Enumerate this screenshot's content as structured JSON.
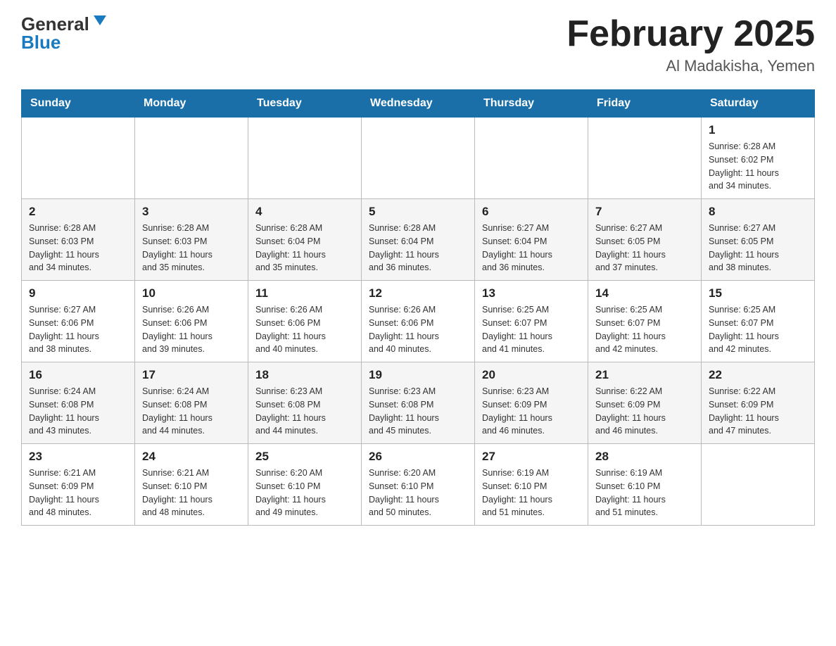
{
  "header": {
    "logo_general": "General",
    "logo_blue": "Blue",
    "month_title": "February 2025",
    "location": "Al Madakisha, Yemen"
  },
  "weekdays": [
    "Sunday",
    "Monday",
    "Tuesday",
    "Wednesday",
    "Thursday",
    "Friday",
    "Saturday"
  ],
  "weeks": [
    [
      {
        "day": "",
        "info": ""
      },
      {
        "day": "",
        "info": ""
      },
      {
        "day": "",
        "info": ""
      },
      {
        "day": "",
        "info": ""
      },
      {
        "day": "",
        "info": ""
      },
      {
        "day": "",
        "info": ""
      },
      {
        "day": "1",
        "info": "Sunrise: 6:28 AM\nSunset: 6:02 PM\nDaylight: 11 hours\nand 34 minutes."
      }
    ],
    [
      {
        "day": "2",
        "info": "Sunrise: 6:28 AM\nSunset: 6:03 PM\nDaylight: 11 hours\nand 34 minutes."
      },
      {
        "day": "3",
        "info": "Sunrise: 6:28 AM\nSunset: 6:03 PM\nDaylight: 11 hours\nand 35 minutes."
      },
      {
        "day": "4",
        "info": "Sunrise: 6:28 AM\nSunset: 6:04 PM\nDaylight: 11 hours\nand 35 minutes."
      },
      {
        "day": "5",
        "info": "Sunrise: 6:28 AM\nSunset: 6:04 PM\nDaylight: 11 hours\nand 36 minutes."
      },
      {
        "day": "6",
        "info": "Sunrise: 6:27 AM\nSunset: 6:04 PM\nDaylight: 11 hours\nand 36 minutes."
      },
      {
        "day": "7",
        "info": "Sunrise: 6:27 AM\nSunset: 6:05 PM\nDaylight: 11 hours\nand 37 minutes."
      },
      {
        "day": "8",
        "info": "Sunrise: 6:27 AM\nSunset: 6:05 PM\nDaylight: 11 hours\nand 38 minutes."
      }
    ],
    [
      {
        "day": "9",
        "info": "Sunrise: 6:27 AM\nSunset: 6:06 PM\nDaylight: 11 hours\nand 38 minutes."
      },
      {
        "day": "10",
        "info": "Sunrise: 6:26 AM\nSunset: 6:06 PM\nDaylight: 11 hours\nand 39 minutes."
      },
      {
        "day": "11",
        "info": "Sunrise: 6:26 AM\nSunset: 6:06 PM\nDaylight: 11 hours\nand 40 minutes."
      },
      {
        "day": "12",
        "info": "Sunrise: 6:26 AM\nSunset: 6:06 PM\nDaylight: 11 hours\nand 40 minutes."
      },
      {
        "day": "13",
        "info": "Sunrise: 6:25 AM\nSunset: 6:07 PM\nDaylight: 11 hours\nand 41 minutes."
      },
      {
        "day": "14",
        "info": "Sunrise: 6:25 AM\nSunset: 6:07 PM\nDaylight: 11 hours\nand 42 minutes."
      },
      {
        "day": "15",
        "info": "Sunrise: 6:25 AM\nSunset: 6:07 PM\nDaylight: 11 hours\nand 42 minutes."
      }
    ],
    [
      {
        "day": "16",
        "info": "Sunrise: 6:24 AM\nSunset: 6:08 PM\nDaylight: 11 hours\nand 43 minutes."
      },
      {
        "day": "17",
        "info": "Sunrise: 6:24 AM\nSunset: 6:08 PM\nDaylight: 11 hours\nand 44 minutes."
      },
      {
        "day": "18",
        "info": "Sunrise: 6:23 AM\nSunset: 6:08 PM\nDaylight: 11 hours\nand 44 minutes."
      },
      {
        "day": "19",
        "info": "Sunrise: 6:23 AM\nSunset: 6:08 PM\nDaylight: 11 hours\nand 45 minutes."
      },
      {
        "day": "20",
        "info": "Sunrise: 6:23 AM\nSunset: 6:09 PM\nDaylight: 11 hours\nand 46 minutes."
      },
      {
        "day": "21",
        "info": "Sunrise: 6:22 AM\nSunset: 6:09 PM\nDaylight: 11 hours\nand 46 minutes."
      },
      {
        "day": "22",
        "info": "Sunrise: 6:22 AM\nSunset: 6:09 PM\nDaylight: 11 hours\nand 47 minutes."
      }
    ],
    [
      {
        "day": "23",
        "info": "Sunrise: 6:21 AM\nSunset: 6:09 PM\nDaylight: 11 hours\nand 48 minutes."
      },
      {
        "day": "24",
        "info": "Sunrise: 6:21 AM\nSunset: 6:10 PM\nDaylight: 11 hours\nand 48 minutes."
      },
      {
        "day": "25",
        "info": "Sunrise: 6:20 AM\nSunset: 6:10 PM\nDaylight: 11 hours\nand 49 minutes."
      },
      {
        "day": "26",
        "info": "Sunrise: 6:20 AM\nSunset: 6:10 PM\nDaylight: 11 hours\nand 50 minutes."
      },
      {
        "day": "27",
        "info": "Sunrise: 6:19 AM\nSunset: 6:10 PM\nDaylight: 11 hours\nand 51 minutes."
      },
      {
        "day": "28",
        "info": "Sunrise: 6:19 AM\nSunset: 6:10 PM\nDaylight: 11 hours\nand 51 minutes."
      },
      {
        "day": "",
        "info": ""
      }
    ]
  ]
}
